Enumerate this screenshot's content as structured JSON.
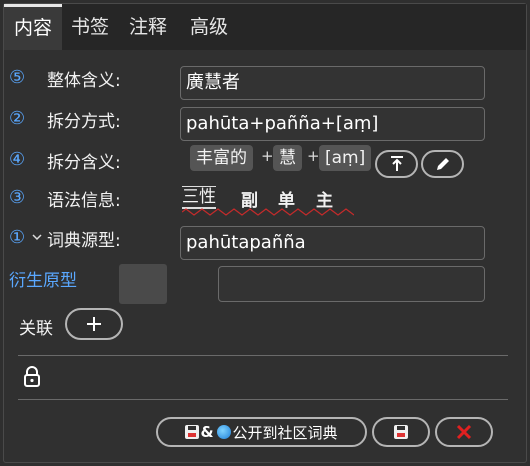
{
  "tabs": [
    {
      "label": "内容",
      "active": true
    },
    {
      "label": "书签",
      "active": false
    },
    {
      "label": "注释",
      "active": false
    },
    {
      "label": "高级",
      "active": false
    }
  ],
  "rows": {
    "overall": {
      "num": "⑤",
      "label": "整体含义:",
      "value": "廣慧者"
    },
    "split_method": {
      "num": "②",
      "label": "拆分方式:",
      "value": "pahūta+pañña+[aṃ]"
    },
    "split_meaning": {
      "num": "④",
      "label": "拆分含义:",
      "parts": [
        "丰富的",
        "慧",
        "[aṃ]"
      ],
      "joiner": "+"
    },
    "grammar": {
      "num": "③",
      "label": "语法信息:",
      "tags": [
        "三性",
        "副",
        "单",
        "主"
      ]
    },
    "dict_form": {
      "num": "①",
      "label": "词典源型:",
      "value": "pahūtapañña"
    },
    "derived": {
      "label": "衍生原型",
      "value": ""
    },
    "relation": {
      "label": "关联"
    }
  },
  "footer": {
    "publish_label": "公开到社区词典",
    "amp": "&"
  },
  "icons": {
    "toolbar_up": "arrow-to-top-icon",
    "edit": "pencil-icon",
    "lock": "lock-icon",
    "save": "floppy-disk-icon",
    "globe": "globe-icon",
    "cancel": "x-icon",
    "add": "plus-icon",
    "chevron": "chevron-down-icon"
  },
  "colors": {
    "accent": "#5aa8ff",
    "cancel": "#e02020",
    "background": "#303030"
  }
}
